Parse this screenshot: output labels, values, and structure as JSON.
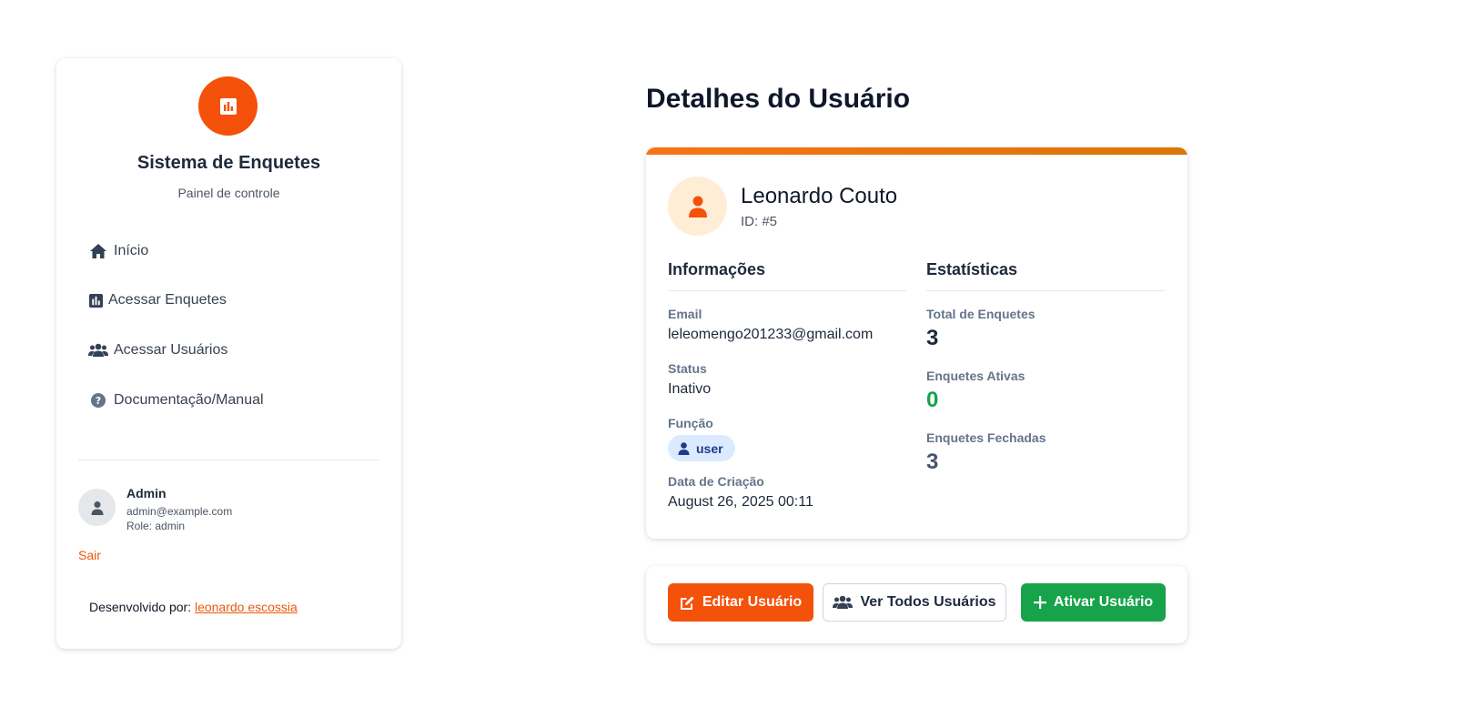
{
  "sidebar": {
    "brand_title": "Sistema de Enquetes",
    "brand_subtitle": "Painel de controle",
    "nav": [
      {
        "label": "Início",
        "icon": "home-icon"
      },
      {
        "label": "Acessar Enquetes",
        "icon": "chart-icon"
      },
      {
        "label": "Acessar Usuários",
        "icon": "users-icon"
      },
      {
        "label": "Documentação/Manual",
        "icon": "question-circle-icon"
      }
    ],
    "current_user": {
      "name": "Admin",
      "email": "admin@example.com",
      "role": "Role: admin"
    },
    "logout_label": "Sair",
    "credit_prefix": "Desenvolvido por: ",
    "credit_link": "leonardo escossia"
  },
  "main": {
    "page_title": "Detalhes do Usuário",
    "profile": {
      "name": "Leonardo Couto",
      "id_text": "ID: #5"
    },
    "info": {
      "title": "Informações",
      "email_label": "Email",
      "email_value": "leleomengo201233@gmail.com",
      "status_label": "Status",
      "status_value": "Inativo",
      "role_label": "Função",
      "role_value": "user",
      "created_label": "Data de Criação",
      "created_value": "August 26, 2025 00:11"
    },
    "stats": {
      "title": "Estatísticas",
      "total_label": "Total de Enquetes",
      "total_value": "3",
      "active_label": "Enquetes Ativas",
      "active_value": "0",
      "closed_label": "Enquetes Fechadas",
      "closed_value": "3"
    },
    "actions": {
      "edit_label": "Editar Usuário",
      "all_label": "Ver Todos Usuários",
      "activate_label": "Ativar Usuário"
    }
  },
  "colors": {
    "brand_orange": "#f4510b",
    "success_green": "#16a34a",
    "badge_blue_bg": "#dbeafe",
    "slate_value": "#475569"
  }
}
